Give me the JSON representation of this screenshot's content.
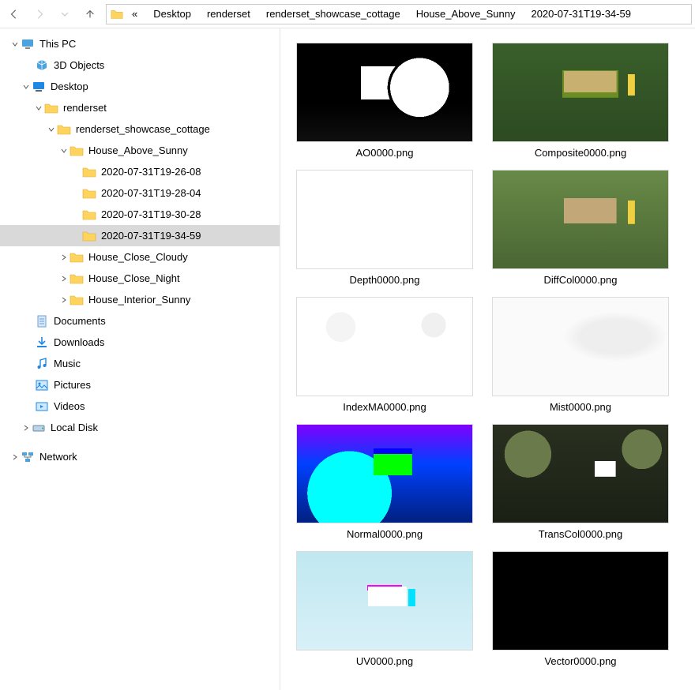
{
  "breadcrumb": {
    "overflow_indicator": "«",
    "items": [
      "Desktop",
      "renderset",
      "renderset_showcase_cottage",
      "House_Above_Sunny",
      "2020-07-31T19-34-59"
    ]
  },
  "sidebar": {
    "this_pc": "This PC",
    "objects3d": "3D Objects",
    "desktop": "Desktop",
    "renderset": "renderset",
    "showcase": "renderset_showcase_cottage",
    "house_above": "House_Above_Sunny",
    "ts1": "2020-07-31T19-26-08",
    "ts2": "2020-07-31T19-28-04",
    "ts3": "2020-07-31T19-30-28",
    "ts4": "2020-07-31T19-34-59",
    "house_cloudy": "House_Close_Cloudy",
    "house_night": "House_Close_Night",
    "house_interior": "House_Interior_Sunny",
    "documents": "Documents",
    "downloads": "Downloads",
    "music": "Music",
    "pictures": "Pictures",
    "videos": "Videos",
    "localdisk": "Local Disk",
    "network": "Network"
  },
  "files": {
    "ao": "AO0000.png",
    "composite": "Composite0000.png",
    "depth": "Depth0000.png",
    "diffcol": "DiffCol0000.png",
    "indexma": "IndexMA0000.png",
    "mist": "Mist0000.png",
    "normal": "Normal0000.png",
    "transcol": "TransCol0000.png",
    "uv": "UV0000.png",
    "vector": "Vector0000.png"
  }
}
